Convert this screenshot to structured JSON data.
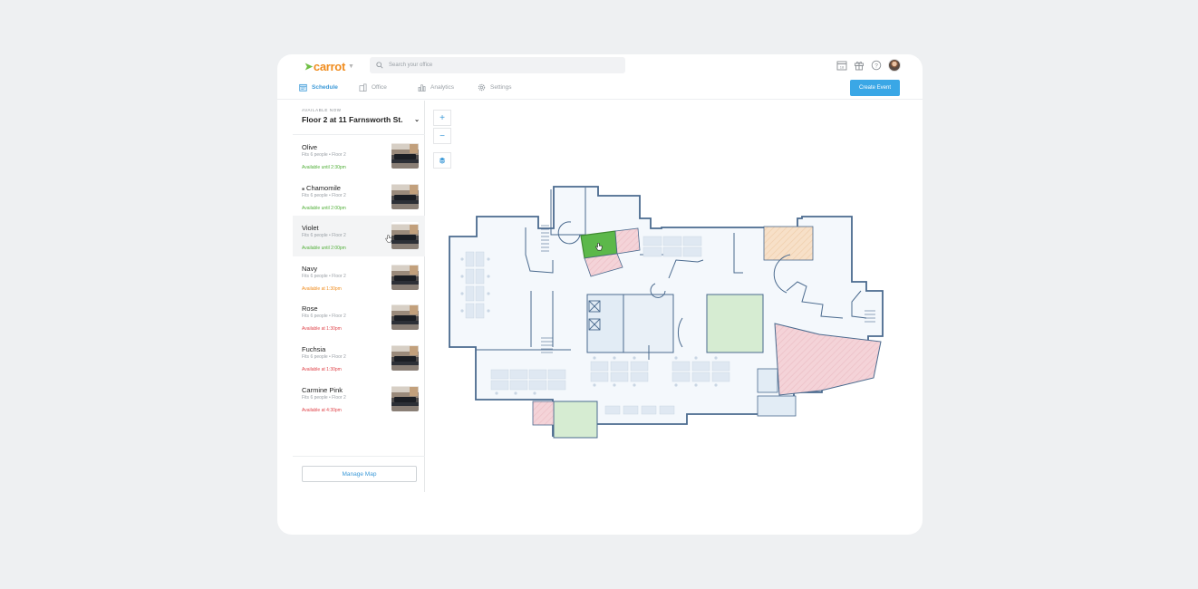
{
  "app": {
    "logo_text": "carrot",
    "logo_mark": "➤",
    "brand_color": "#f08c1e",
    "accent_color": "#3aa7e6"
  },
  "search": {
    "placeholder": "Search your office"
  },
  "top_icons": [
    "calendar-icon",
    "gift-icon",
    "help-icon",
    "avatar"
  ],
  "calendar_day": "18",
  "nav": {
    "items": [
      {
        "label": "Schedule",
        "icon": "calendar-icon",
        "active": true
      },
      {
        "label": "Office",
        "icon": "office-icon",
        "active": false
      },
      {
        "label": "Analytics",
        "icon": "analytics-icon",
        "active": false
      },
      {
        "label": "Settings",
        "icon": "gear-icon",
        "active": false
      }
    ],
    "create_event": "Create Event"
  },
  "sidebar": {
    "available_label": "AVAILABLE NOW",
    "floor": "Floor 2 at 11 Farnsworth St.",
    "rooms": [
      {
        "name": "Olive",
        "details": "Fits 6 people • Floor 2",
        "status": "Available until 2:30pm",
        "status_color": "#52b03a"
      },
      {
        "name": "Chamomile",
        "details": "Fits 6 people • Floor 2",
        "status": "Available until 2:00pm",
        "status_color": "#52b03a"
      },
      {
        "name": "Violet",
        "details": "Fits 6 people • Floor 2",
        "status": "Available until 2:00pm",
        "status_color": "#52b03a"
      },
      {
        "name": "Navy",
        "details": "Fits 6 people • Floor 2",
        "status": "Available at 1:30pm",
        "status_color": "#f08c1e"
      },
      {
        "name": "Rose",
        "details": "Fits 6 people • Floor 2",
        "status": "Available at 1:30pm",
        "status_color": "#e0454b"
      },
      {
        "name": "Fuchsia",
        "details": "Fits 6 people • Floor 2",
        "status": "Available at 1:30pm",
        "status_color": "#e0454b"
      },
      {
        "name": "Carmine Pink",
        "details": "Fits 6 people • Floor 2",
        "status": "Available at 4:30pm",
        "status_color": "#e0454b"
      }
    ],
    "manage_map": "Manage Map"
  },
  "map_controls": {
    "zoom_in": "+",
    "zoom_out": "−",
    "layers": "layers-icon"
  },
  "map_colors": {
    "wall": "#4a6a8e",
    "floor": "#f4f8fc",
    "available": "#d6ecd2",
    "selected": "#5cb84a",
    "busy": "#f4d3d8",
    "soon": "#f7dcc0",
    "desk": "#dfe8f2"
  }
}
